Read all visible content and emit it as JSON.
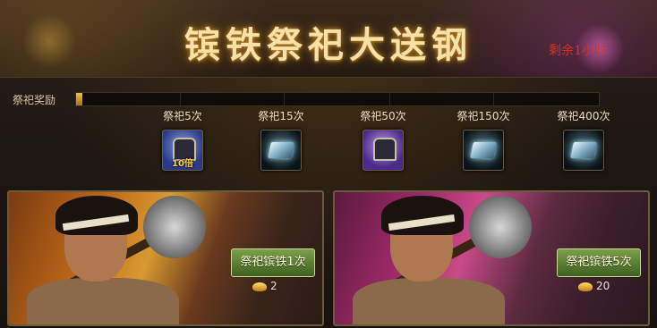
{
  "header": {
    "title": "镔铁祭祀大送钢",
    "timer": "剩余1小时"
  },
  "progress": {
    "label": "祭祀奖励",
    "fraction": 0.01
  },
  "milestones": [
    {
      "label": "祭祀5次",
      "icon": "treasure-chest-icon",
      "multiplier": "10倍"
    },
    {
      "label": "祭祀15次",
      "icon": "steel-ingot-icon"
    },
    {
      "label": "祭祀50次",
      "icon": "treasure-chest-icon",
      "multiplier": ""
    },
    {
      "label": "祭祀150次",
      "icon": "steel-ingot-icon"
    },
    {
      "label": "祭祀400次",
      "icon": "steel-ingot-icon"
    }
  ],
  "panels": [
    {
      "button": "祭祀镔铁1次",
      "cost": "2",
      "cost_icon": "gold-ingot-icon"
    },
    {
      "button": "祭祀镔铁5次",
      "cost": "20",
      "cost_icon": "gold-ingot-icon"
    }
  ],
  "colors": {
    "title": "#f6e2a8",
    "timer": "#d83020",
    "button": "#5a8034",
    "progress": "#e0a828"
  }
}
